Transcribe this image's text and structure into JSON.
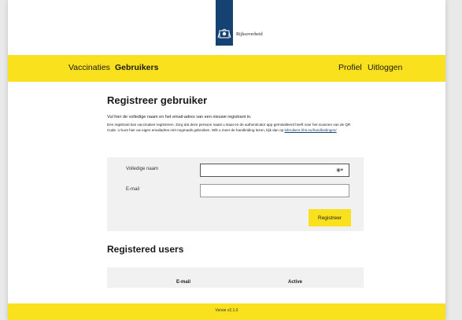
{
  "header": {
    "logo_text": "Rijksoverheid"
  },
  "nav": {
    "left": [
      "Vaccinaties",
      "Gebruikers"
    ],
    "right": [
      "Profiel",
      "Uitloggen"
    ],
    "active": "Gebruikers"
  },
  "page": {
    "title": "Registreer gebruiker",
    "intro": "Vul hier de volledige naam en het email-adres van een nieuwe registrant in.",
    "help_text": "Een registrant kan vaccinaties registreren. Zorg dat deze persoon naast u staat en de authenticator app geïnstalleerd heeft voor het scannen van de QR Code. U kunt hier uw eigen emailadres niet nogmaals gebruiken. Wilt u meer de handleiding lezen, kijk dan op",
    "help_link": "lebruikers.hhs.eu/handleidingen/"
  },
  "form": {
    "name_label": "Volledige naam",
    "name_value": "",
    "email_label": "E-mail",
    "email_value": "",
    "submit_label": "Registreer"
  },
  "registered": {
    "title": "Registered users",
    "columns": [
      "E-mail",
      "Active"
    ]
  },
  "footer": {
    "version": "Versie v2.1.0"
  },
  "colors": {
    "brand_yellow": "#f9e11e",
    "brand_blue": "#154273"
  }
}
